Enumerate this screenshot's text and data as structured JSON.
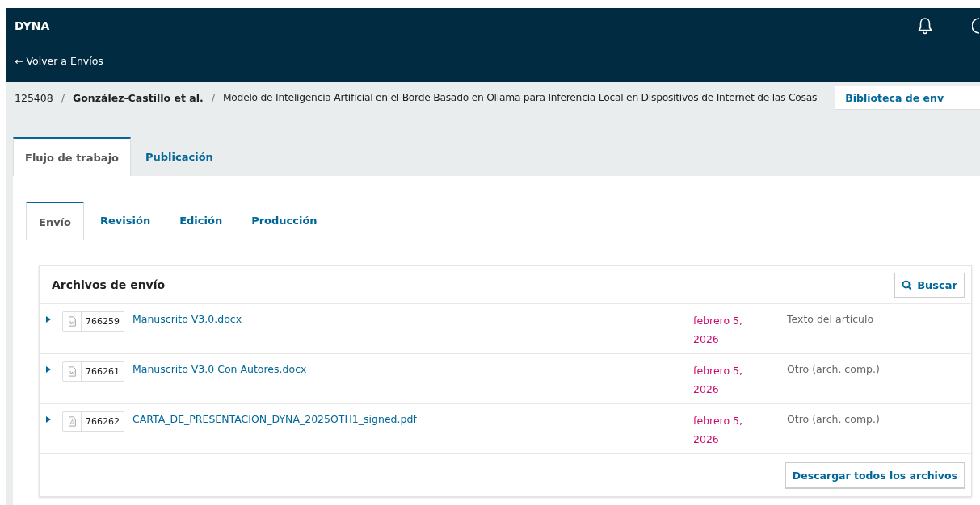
{
  "header": {
    "site_title": "DYNA",
    "back_link": "← Volver a Envíos"
  },
  "breadcrumb": {
    "separators": [
      "/",
      "/"
    ],
    "id": "125408",
    "authors": "González-Castillo et al.",
    "title": "Modelo de Inteligencia Artificial en el Borde Basado en Ollama para Inferencia Local en Dispositivos de Internet de las Cosas",
    "library_button": "Biblioteca de env"
  },
  "tabs": [
    {
      "label": "Flujo de trabajo",
      "selected": true
    },
    {
      "label": "Publicación",
      "selected": false
    }
  ],
  "stage_tabs": [
    {
      "label": "Envío",
      "selected": true
    },
    {
      "label": "Revisión",
      "selected": false
    },
    {
      "label": "Edición",
      "selected": false
    },
    {
      "label": "Producción",
      "selected": false
    }
  ],
  "files_panel": {
    "title": "Archivos de envío",
    "search_button": "Buscar",
    "files": [
      {
        "kind": "word",
        "id": "766259",
        "name": "Manuscrito V3.0.docx",
        "date": "febrero 5, 2026",
        "type": "Texto del artículo",
        "expanded": false
      },
      {
        "kind": "word",
        "id": "766261",
        "name": "Manuscrito V3.0 Con Autores.docx",
        "date": "febrero 5, 2026",
        "type": "Otro (arch. comp.)",
        "expanded": false
      },
      {
        "kind": "pdf",
        "id": "766262",
        "name": "CARTA_DE_PRESENTACION_DYNA_2025OTH1_signed.pdf",
        "date": "febrero 5, 2026",
        "type": "Otro (arch. comp.)",
        "expanded": false
      }
    ],
    "download_all_button": "Descargar todos los archivos"
  }
}
